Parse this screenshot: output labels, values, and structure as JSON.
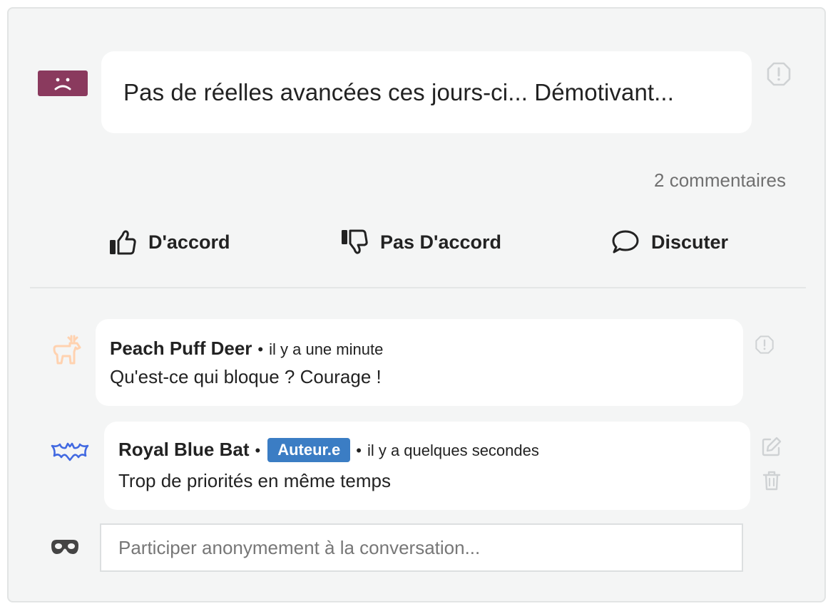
{
  "post": {
    "mood_icon": "sad-face-icon",
    "mood_color": "#8a3a5e",
    "text": "Pas de réelles avancées ces jours-ci... Démotivant...",
    "report_icon": "alert-octagon-icon"
  },
  "stats": {
    "comment_count": "2 commentaires"
  },
  "actions": {
    "agree": {
      "label": "D'accord",
      "icon": "thumbs-up-icon"
    },
    "disagree": {
      "label": "Pas D'accord",
      "icon": "thumbs-down-icon"
    },
    "discuss": {
      "label": "Discuter",
      "icon": "speech-bubble-icon"
    }
  },
  "comments": [
    {
      "author": "Peach Puff Deer",
      "avatar_icon": "deer-icon",
      "avatar_color": "#ffd2b0",
      "time": "il y a une minute",
      "text": "Qu'est-ce qui bloque ? Courage !"
    },
    {
      "author": "Royal Blue Bat",
      "avatar_icon": "bat-icon",
      "avatar_color": "#4169e1",
      "badge": "Auteur.e",
      "badge_color": "#3b7dc4",
      "time": "il y a quelques secondes",
      "text": "Trop de priorités en même temps"
    }
  ],
  "reply": {
    "avatar_icon": "mask-icon",
    "placeholder": "Participer anonymement à la conversation..."
  }
}
